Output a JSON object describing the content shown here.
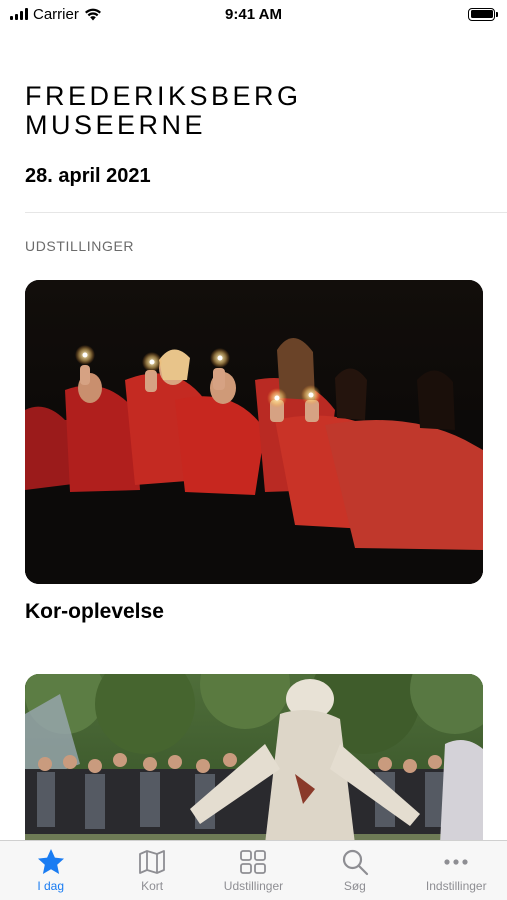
{
  "status_bar": {
    "carrier": "Carrier",
    "time": "9:41 AM"
  },
  "header": {
    "logo_line1": "FREDERIKSBERG",
    "logo_line2": "MUSEERNE",
    "date": "28. april 2021"
  },
  "section": {
    "label": "UDSTILLINGER"
  },
  "cards": [
    {
      "title": "Kor-oplevelse"
    },
    {
      "title": ""
    }
  ],
  "tabs": [
    {
      "label": "I dag",
      "icon": "star-icon",
      "active": true
    },
    {
      "label": "Kort",
      "icon": "map-icon",
      "active": false
    },
    {
      "label": "Udstillinger",
      "icon": "grid-icon",
      "active": false
    },
    {
      "label": "Søg",
      "icon": "search-icon",
      "active": false
    },
    {
      "label": "Indstillinger",
      "icon": "more-icon",
      "active": false
    }
  ],
  "colors": {
    "accent": "#1a7cf2",
    "inactive": "#8e8e93"
  }
}
